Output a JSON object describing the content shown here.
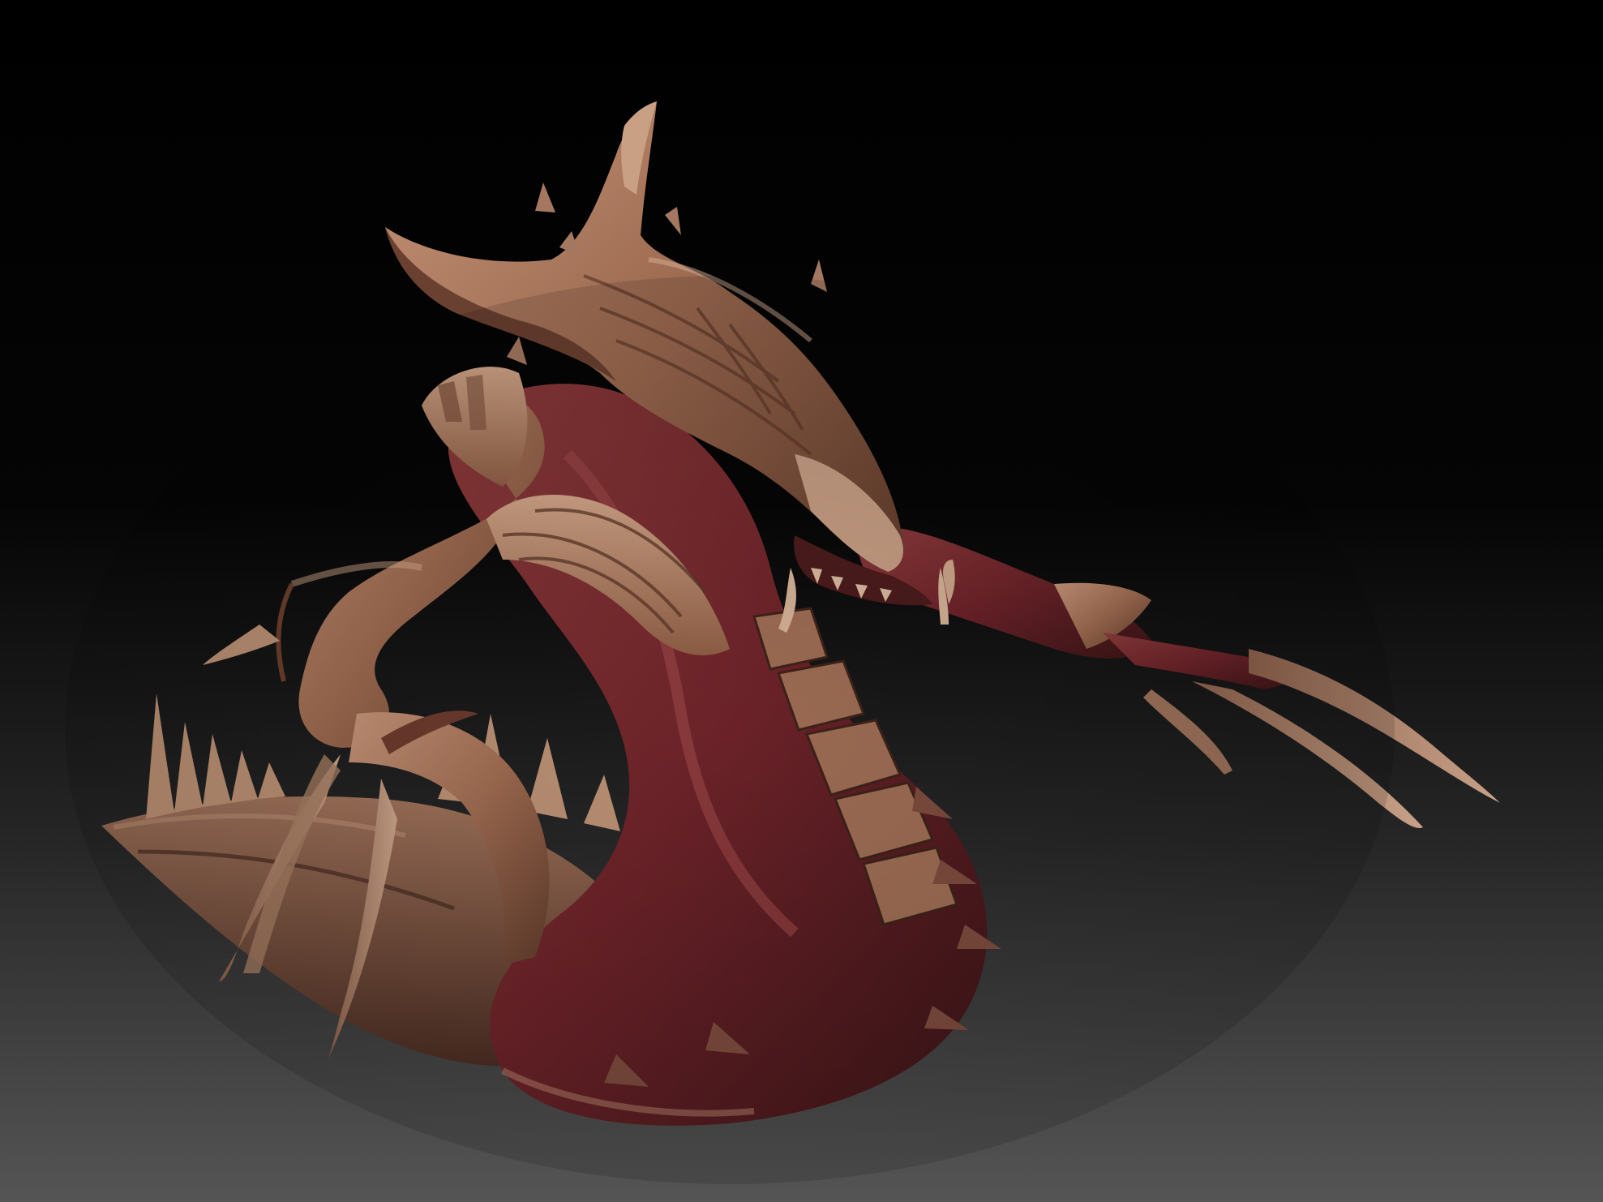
{
  "scene": {
    "background": {
      "top_color": "#000000",
      "bottom_color": "#545454"
    },
    "material": {
      "skin_color": "#a9755a",
      "flesh_color": "#6a2226",
      "shadow_color": "#2a130f",
      "highlight_color": "#caa084"
    },
    "subject": "creature-sculpt"
  }
}
